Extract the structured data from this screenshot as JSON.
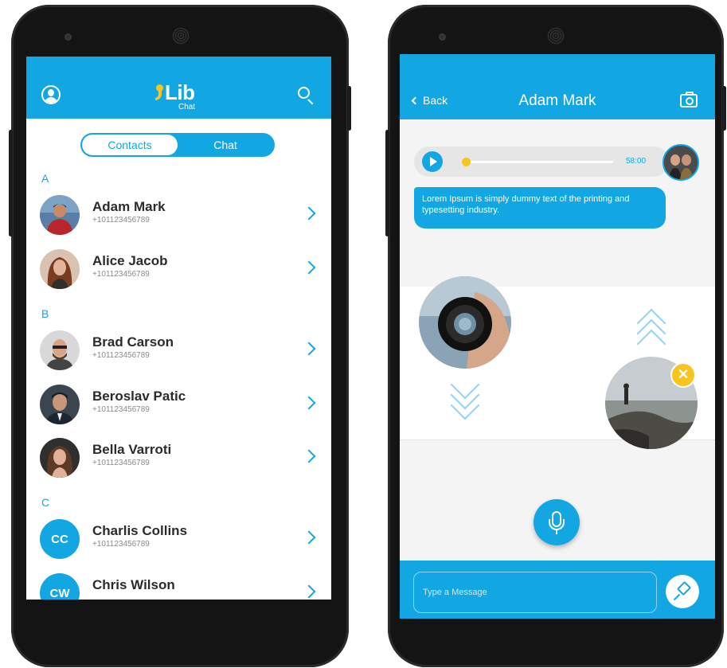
{
  "left_screen": {
    "header": {
      "logo_text": "Lib",
      "logo_sub": "Chat"
    },
    "tabs": [
      {
        "label": "Contacts",
        "active": true
      },
      {
        "label": "Chat",
        "active": false
      }
    ],
    "sections": [
      {
        "letter": "A",
        "contacts": [
          {
            "name": "Adam Mark",
            "phone": "+101123456789"
          },
          {
            "name": "Alice Jacob",
            "phone": "+101123456789"
          }
        ]
      },
      {
        "letter": "B",
        "contacts": [
          {
            "name": "Brad Carson",
            "phone": "+101123456789"
          },
          {
            "name": "Beroslav Patic",
            "phone": "+101123456789"
          },
          {
            "name": "Bella Varroti",
            "phone": "+101123456789"
          }
        ]
      },
      {
        "letter": "C",
        "contacts": [
          {
            "name": "Charlis Collins",
            "phone": "+101123456789",
            "initials": "CC"
          },
          {
            "name": "Chris Wilson",
            "phone": "",
            "initials": "CW"
          }
        ]
      }
    ]
  },
  "right_screen": {
    "header": {
      "back_label": "Back",
      "title": "Adam Mark"
    },
    "audio_message": {
      "time": "58:00",
      "progress": 0.02
    },
    "text_message": "Lorem Ipsum is simply dummy text of the printing and typesetting industry.",
    "composer": {
      "placeholder": "Type a Message"
    }
  },
  "colors": {
    "accent": "#12a6e3",
    "highlight": "#f7c51e",
    "text_dark": "#2b2b2b",
    "text_muted": "#8a8a8a"
  },
  "icons": [
    "user-icon",
    "search-icon",
    "chevron-right-icon",
    "back-chevron-icon",
    "camera-icon",
    "play-icon",
    "microphone-icon",
    "close-icon",
    "pin-icon",
    "up-arrows-icon",
    "down-arrows-icon"
  ]
}
